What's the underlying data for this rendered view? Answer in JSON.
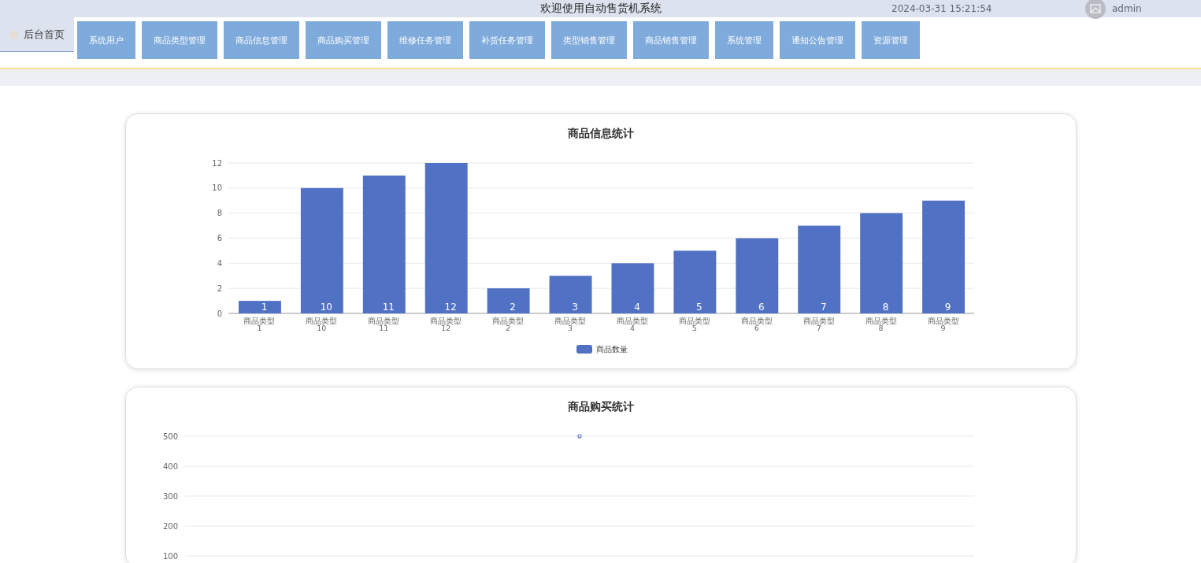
{
  "header": {
    "title": "欢迎使用自动售货机系统",
    "datetime": "2024-03-31 15:21:54",
    "user": "admin"
  },
  "nav": {
    "home": {
      "label": "后台首页",
      "selected": true
    },
    "items": [
      {
        "label": "系统用户",
        "selected": false
      },
      {
        "label": "商品类型管理",
        "selected": false
      },
      {
        "label": "商品信息管理",
        "selected": false
      },
      {
        "label": "商品购买管理",
        "selected": false
      },
      {
        "label": "维修任务管理",
        "selected": false
      },
      {
        "label": "补货任务管理",
        "selected": false
      },
      {
        "label": "类型销售管理",
        "selected": false
      },
      {
        "label": "商品销售管理",
        "selected": false
      },
      {
        "label": "系统管理",
        "selected": false
      },
      {
        "label": "通知公告管理",
        "selected": false
      },
      {
        "label": "资源管理",
        "selected": false
      }
    ]
  },
  "cards": [
    {
      "title": "商品信息统计",
      "chart_data": {
        "type": "bar",
        "categories": [
          "商品类型\n1",
          "商品类型\n10",
          "商品类型\n11",
          "商品类型\n12",
          "商品类型\n2",
          "商品类型\n3",
          "商品类型\n4",
          "商品类型\n5",
          "商品类型\n6",
          "商品类型\n7",
          "商品类型\n8",
          "商品类型\n9"
        ],
        "series": [
          {
            "name": "商品数量",
            "color": "#5171c4",
            "values": [
              1,
              10,
              11,
              12,
              2,
              3,
              4,
              5,
              6,
              7,
              8,
              9
            ]
          }
        ],
        "ylim": [
          0,
          12
        ],
        "yticks": [
          0,
          2,
          4,
          6,
          8,
          10,
          12
        ],
        "grid": true,
        "data_labels": true
      }
    },
    {
      "title": "商品购买统计",
      "chart_data": {
        "type": "line",
        "series": [
          {
            "color": "#5171c4",
            "marker": true,
            "values": [
              500
            ]
          }
        ],
        "ylim": [
          100,
          500
        ],
        "yticks": [
          100,
          200,
          300,
          400,
          500
        ],
        "grid": true
      }
    }
  ]
}
